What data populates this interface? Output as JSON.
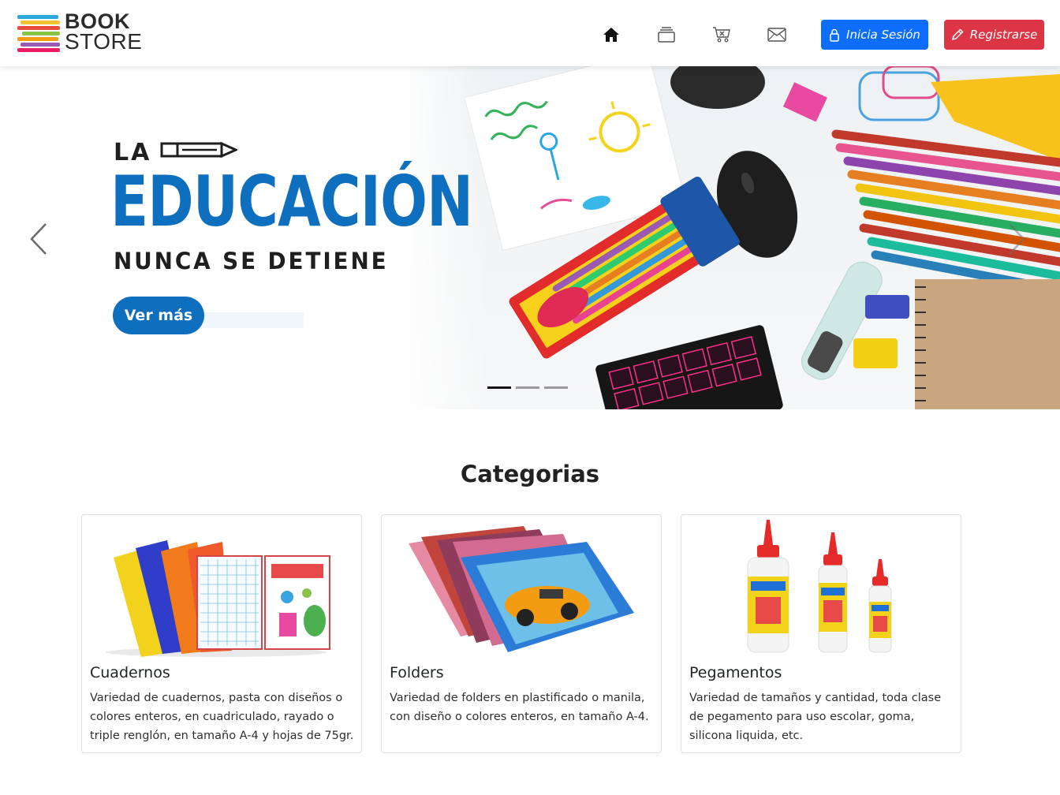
{
  "logo": {
    "line1": "BOOK",
    "line2": "STORE"
  },
  "nav": {
    "icons": [
      "home-icon",
      "layers-icon",
      "cart-icon",
      "mail-icon"
    ],
    "login_label": "Inicia Sesión",
    "register_label": "Registrarse"
  },
  "hero": {
    "line1": "LA",
    "line2": "EDUCACIÓN",
    "line3": "NUNCA SE DETIENE",
    "button_label": "Ver más",
    "slide_count": 3,
    "active_slide": 1
  },
  "categories": {
    "title": "Categorias",
    "items": [
      {
        "title": "Cuadernos",
        "description": "Variedad de cuadernos, pasta con diseños o colores enteros, en cuadriculado, rayado o triple renglón, en tamaño A-4 y hojas de 75gr."
      },
      {
        "title": "Folders",
        "description": "Variedad de folders en plastificado o manila, con diseño o colores enteros, en tamaño A-4."
      },
      {
        "title": "Pegamentos",
        "description": "Variedad de tamaños y cantidad, toda clase de pegamento para uso escolar, goma, silicona liquida, etc."
      }
    ]
  },
  "colors": {
    "primary": "#0d6efd",
    "danger": "#dc3545",
    "hero_blue": "#0f6fbf"
  }
}
